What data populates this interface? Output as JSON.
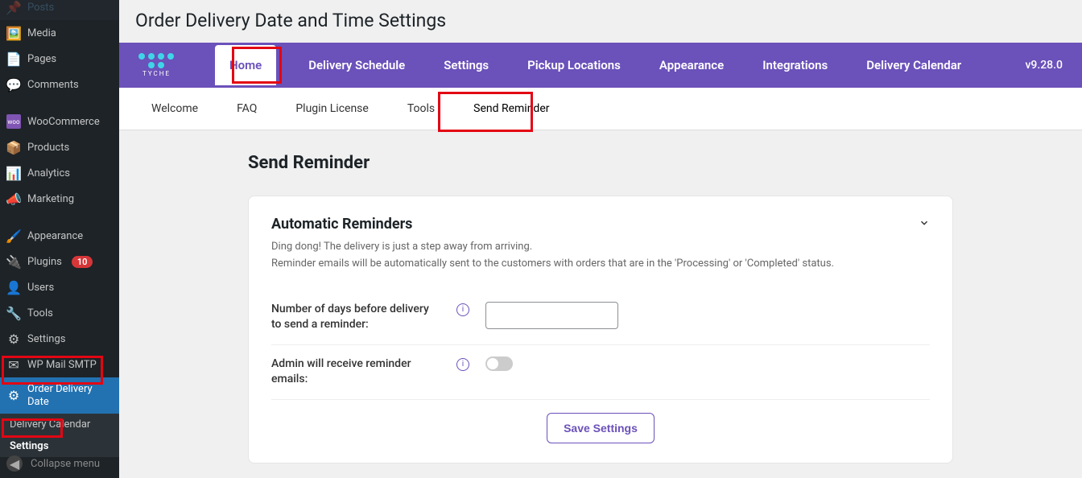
{
  "sidebar": {
    "items": [
      {
        "icon": "pin",
        "label": "Posts"
      },
      {
        "icon": "media",
        "label": "Media"
      },
      {
        "icon": "page",
        "label": "Pages"
      },
      {
        "icon": "comment",
        "label": "Comments"
      },
      {
        "icon": "woo",
        "label": "WooCommerce"
      },
      {
        "icon": "product",
        "label": "Products"
      },
      {
        "icon": "analytics",
        "label": "Analytics"
      },
      {
        "icon": "marketing",
        "label": "Marketing"
      },
      {
        "icon": "brush",
        "label": "Appearance"
      },
      {
        "icon": "plugin",
        "label": "Plugins",
        "badge": "10"
      },
      {
        "icon": "users",
        "label": "Users"
      },
      {
        "icon": "wrench",
        "label": "Tools"
      },
      {
        "icon": "settings",
        "label": "Settings"
      },
      {
        "icon": "mail",
        "label": "WP Mail SMTP"
      },
      {
        "icon": "gear",
        "label": "Order Delivery Date",
        "active": true
      }
    ],
    "sub": [
      {
        "label": "Delivery Calendar"
      },
      {
        "label": "Settings",
        "active": true
      }
    ],
    "collapse": "Collapse menu"
  },
  "header": {
    "title": "Order Delivery Date and Time Settings"
  },
  "topbar": {
    "brand": "TYCHE",
    "items": [
      "Home",
      "Delivery Schedule",
      "Settings",
      "Pickup Locations",
      "Appearance",
      "Integrations",
      "Delivery Calendar"
    ],
    "version": "v9.28.0"
  },
  "subnav": [
    "Welcome",
    "FAQ",
    "Plugin License",
    "Tools",
    "Send Reminder"
  ],
  "content": {
    "section_title": "Send Reminder",
    "card_title": "Automatic Reminders",
    "desc1": "Ding dong! The delivery is just a step away from arriving.",
    "desc2": "Reminder emails will be automatically sent to the customers with orders that are in the 'Processing' or 'Completed' status.",
    "field1_label": "Number of days before delivery to send a reminder:",
    "field1_value": "",
    "field2_label": "Admin will receive reminder emails:",
    "save_label": "Save Settings"
  }
}
